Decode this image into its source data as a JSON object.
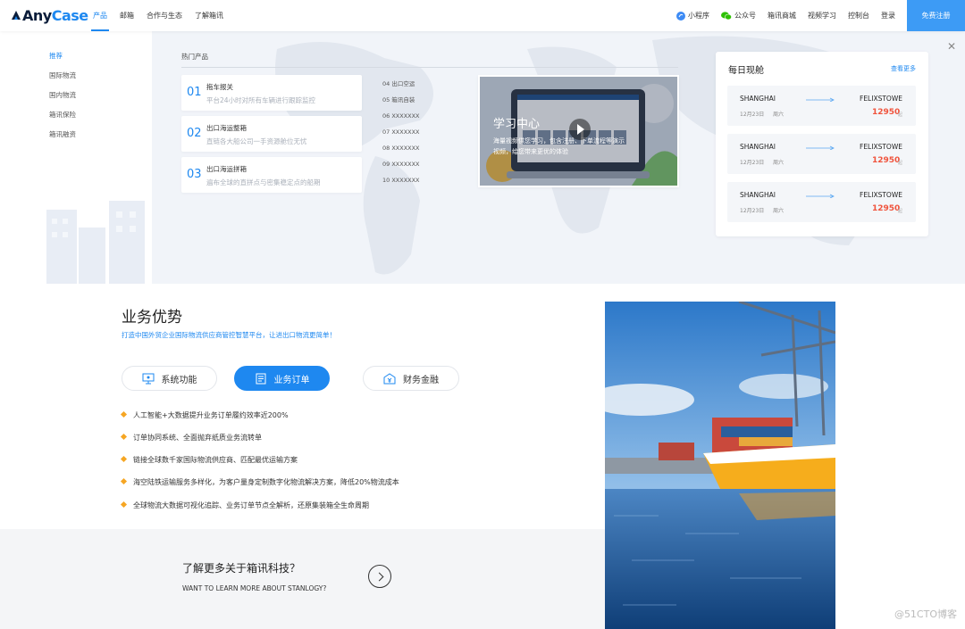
{
  "header": {
    "logo_any": "Any",
    "logo_case": "Case",
    "nav_left": [
      "产品",
      "邮箱",
      "合作与生态",
      "了解箱讯"
    ],
    "nav_right": [
      {
        "label": "小程序",
        "icon": "mini-program-icon"
      },
      {
        "label": "公众号",
        "icon": "wechat-icon"
      },
      {
        "label": "箱讯商城"
      },
      {
        "label": "视频学习"
      },
      {
        "label": "控制台"
      },
      {
        "label": "登录"
      }
    ],
    "register": "免费注册"
  },
  "sidebar": {
    "items": [
      "推荐",
      "国际物流",
      "国内物流",
      "箱讯保险",
      "箱讯融资"
    ]
  },
  "hot": {
    "title": "热门产品",
    "cards": [
      {
        "num": "01",
        "title": "拖车报关",
        "desc": "平台24小时对所有车辆进行跟踪监控"
      },
      {
        "num": "02",
        "title": "出口海运整箱",
        "desc": "直链各大船公司一手资源舱位无忧"
      },
      {
        "num": "03",
        "title": "出口海运拼箱",
        "desc": "遍布全球的直拼点与密集稳定点的船期"
      }
    ],
    "mini_list": [
      "04 出口空运",
      "05 箱讯自装",
      "06 XXXXXXX",
      "07 XXXXXXX",
      "08 XXXXXXX",
      "09 XXXXXXX",
      "10 XXXXXXX"
    ]
  },
  "video": {
    "title": "学习中心",
    "desc": "海量视频供您学习，包含注册、下单流程等演示视频，给您带来更优的体验"
  },
  "shipping": {
    "title": "每日现舱",
    "more": "查看更多",
    "routes": [
      {
        "from": "SHANGHAI",
        "to": "FELIXSTOWE",
        "date": "12月23日",
        "day": "周六",
        "price": "12950",
        "unit": "起"
      },
      {
        "from": "SHANGHAI",
        "to": "FELIXSTOWE",
        "date": "12月23日",
        "day": "周六",
        "price": "12950",
        "unit": "起"
      },
      {
        "from": "SHANGHAI",
        "to": "FELIXSTOWE",
        "date": "12月23日",
        "day": "周六",
        "price": "12950",
        "unit": "起"
      }
    ]
  },
  "advantage": {
    "title": "业务优势",
    "subtitle": "打造中国外贸企业国际物流供应商管控智慧平台，让进出口物流更简单！",
    "tabs": [
      {
        "label": "系统功能",
        "icon": "monitor-icon"
      },
      {
        "label": "业务订单",
        "icon": "order-icon"
      },
      {
        "label": "财务金融",
        "icon": "finance-icon"
      }
    ],
    "features": [
      "人工智能+大数据提升业务订单履约效率近200%",
      "订单协同系统、全面抛弃纸质业务流转单",
      "链接全球数千家国际物流供应商、匹配最优运输方案",
      "海空陆铁运输服务多样化，为客户量身定制数字化物流解决方案，降低20%物流成本",
      "全球物流大数据可视化追踪、业务订单节点全解析，还原集装箱全生命周期"
    ]
  },
  "learn": {
    "cn": "了解更多关于箱讯科技？",
    "en": "WANT TO LEARN MORE ABOUT STANLOGY?"
  },
  "watermark": "@51CTO博客",
  "colors": {
    "accent": "#1e88f0",
    "price": "#f0533c",
    "feature_dot": "#f6a623"
  }
}
